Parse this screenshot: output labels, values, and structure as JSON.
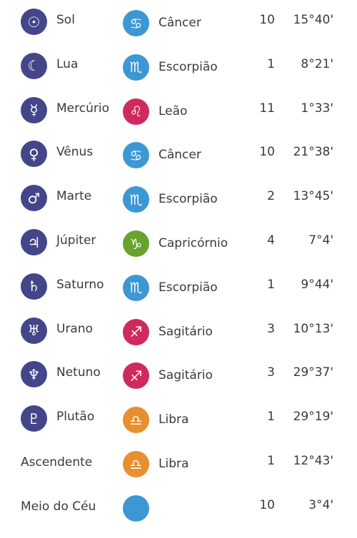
{
  "colors": {
    "planet_icon_bg": "#44468a",
    "water_sign": "#3d97d3",
    "fire_sign": "#cf2a5d",
    "earth_sign": "#68a32e",
    "air_sign": "#e88f2f",
    "text": "#3a3a3a"
  },
  "rows": [
    {
      "planet": "Sol",
      "planet_icon": "sun-icon",
      "planet_glyph": "☉",
      "sign": "Câncer",
      "sign_icon": "cancer-icon",
      "sign_glyph": "♋",
      "sign_color": "#3d97d3",
      "house": "10",
      "degree": "15°40'"
    },
    {
      "planet": "Lua",
      "planet_icon": "moon-icon",
      "planet_glyph": "☾",
      "sign": "Escorpião",
      "sign_icon": "scorpio-icon",
      "sign_glyph": "♏",
      "sign_color": "#3d97d3",
      "house": "1",
      "degree": "8°21'"
    },
    {
      "planet": "Mercúrio",
      "planet_icon": "mercury-icon",
      "planet_glyph": "☿",
      "sign": "Leão",
      "sign_icon": "leo-icon",
      "sign_glyph": "♌",
      "sign_color": "#cf2a5d",
      "house": "11",
      "degree": "1°33'"
    },
    {
      "planet": "Vênus",
      "planet_icon": "venus-icon",
      "planet_glyph": "♀",
      "sign": "Câncer",
      "sign_icon": "cancer-icon",
      "sign_glyph": "♋",
      "sign_color": "#3d97d3",
      "house": "10",
      "degree": "21°38'"
    },
    {
      "planet": "Marte",
      "planet_icon": "mars-icon",
      "planet_glyph": "♂",
      "sign": "Escorpião",
      "sign_icon": "scorpio-icon",
      "sign_glyph": "♏",
      "sign_color": "#3d97d3",
      "house": "2",
      "degree": "13°45'"
    },
    {
      "planet": "Júpiter",
      "planet_icon": "jupiter-icon",
      "planet_glyph": "♃",
      "sign": "Capricórnio",
      "sign_icon": "capricorn-icon",
      "sign_glyph": "♑",
      "sign_color": "#68a32e",
      "house": "4",
      "degree": "7°4'"
    },
    {
      "planet": "Saturno",
      "planet_icon": "saturn-icon",
      "planet_glyph": "♄",
      "sign": "Escorpião",
      "sign_icon": "scorpio-icon",
      "sign_glyph": "♏",
      "sign_color": "#3d97d3",
      "house": "1",
      "degree": "9°44'"
    },
    {
      "planet": "Urano",
      "planet_icon": "uranus-icon",
      "planet_glyph": "♅",
      "sign": "Sagitário",
      "sign_icon": "sagittarius-icon",
      "sign_glyph": "♐",
      "sign_color": "#cf2a5d",
      "house": "3",
      "degree": "10°13'"
    },
    {
      "planet": "Netuno",
      "planet_icon": "neptune-icon",
      "planet_glyph": "♆",
      "sign": "Sagitário",
      "sign_icon": "sagittarius-icon",
      "sign_glyph": "♐",
      "sign_color": "#cf2a5d",
      "house": "3",
      "degree": "29°37'"
    },
    {
      "planet": "Plutão",
      "planet_icon": "pluto-icon",
      "planet_glyph": "♇",
      "sign": "Libra",
      "sign_icon": "libra-icon",
      "sign_glyph": "♎",
      "sign_color": "#e88f2f",
      "house": "1",
      "degree": "29°19'"
    },
    {
      "planet": "Ascendente",
      "planet_icon": "",
      "planet_glyph": "",
      "sign": "Libra",
      "sign_icon": "libra-icon",
      "sign_glyph": "♎",
      "sign_color": "#e88f2f",
      "house": "1",
      "degree": "12°43'"
    },
    {
      "planet": "Meio do Céu",
      "planet_icon": "",
      "planet_glyph": "",
      "sign": "",
      "sign_icon": "partial-sign-icon",
      "sign_glyph": "",
      "sign_color": "#3d97d3",
      "house": "10",
      "degree": "3°4'"
    }
  ]
}
